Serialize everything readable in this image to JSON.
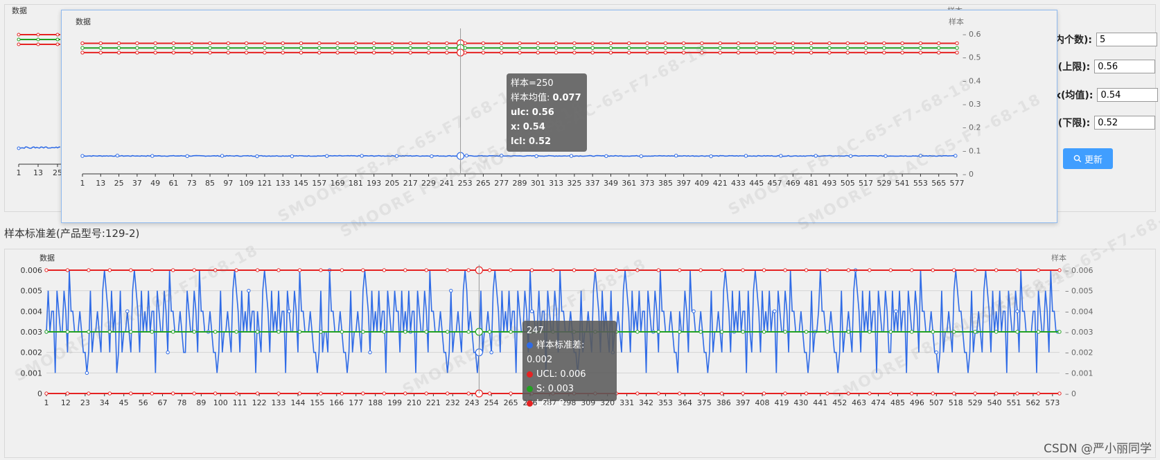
{
  "watermark": "SMOORE F8-AC-65-F7-68-18",
  "params": {
    "group_size_label": "内个数):",
    "group_size_value": "5",
    "ucl_label": "l(上限):",
    "ucl_value": "0.56",
    "mean_label": "x(均值):",
    "mean_value": "0.54",
    "lcl_label": "l(下限):",
    "lcl_value": "0.52",
    "update_label": "更新"
  },
  "s_chart_title": "样本标准差(产品型号:129-2)",
  "xbar_tooltip": {
    "sample": "样本=250",
    "mean_label": "样本均值:",
    "mean_value": "0.077",
    "ucl_label": "ulc:",
    "ucl_value": "0.56",
    "x_label": "x:",
    "x_value": "0.54",
    "lcl_label": "lcl:",
    "lcl_value": "0.52"
  },
  "s_tooltip": {
    "sample": "247",
    "series_s": "样本标准差: 0.002",
    "series_ucl": "UCL: 0.006",
    "series_mean": "S: 0.003",
    "series_lcl": "LCL: 0"
  },
  "csdn_credit": "CSDN @严小丽同学",
  "chart_data": [
    {
      "id": "xbar-background",
      "type": "line",
      "xlabel": "",
      "ylabel": "数据",
      "ylabel_right": "样本",
      "x_ticks_visible": [
        "1",
        "13",
        "25"
      ],
      "series_colors": {
        "value": "#2f6be6",
        "ucl": "#e52222",
        "mean": "#21a121",
        "lcl": "#e52222"
      }
    },
    {
      "id": "xbar-popup",
      "type": "line",
      "ylabel": "数据",
      "ylabel_right": "样本",
      "n_points": 577,
      "x_tick_step": 12,
      "ylim": [
        0,
        0.6
      ],
      "y_ticks": [
        0,
        0.1,
        0.2,
        0.3,
        0.4,
        0.5,
        0.6
      ],
      "series": [
        {
          "name": "样本均值",
          "color": "#2f6be6",
          "base": 0.077,
          "noise": 0.003
        },
        {
          "name": "ulc",
          "color": "#e52222",
          "constant": 0.56
        },
        {
          "name": "x",
          "color": "#21a121",
          "constant": 0.54
        },
        {
          "name": "lcl",
          "color": "#e52222",
          "constant": 0.52
        }
      ],
      "highlight_index": 250
    },
    {
      "id": "s-chart",
      "type": "line",
      "ylabel": "数据",
      "ylabel_right": "样本",
      "n_points": 577,
      "x_tick_step": 11,
      "ylim": [
        0,
        0.006
      ],
      "y_ticks": [
        0,
        0.001,
        0.002,
        0.003,
        0.004,
        0.005,
        0.006
      ],
      "series": [
        {
          "name": "样本标准差",
          "color": "#2f6be6",
          "values_pattern": [
            0.003,
            0.001,
            0.005,
            0.004,
            0.002,
            0.004,
            0.003,
            0.005,
            0.002,
            0.004,
            0.003,
            0.006,
            0.002,
            0.004,
            0.003,
            0.005,
            0.003,
            0.002,
            0.004,
            0.005,
            0.003,
            0.004,
            0.002,
            0.003,
            0.005,
            0.004,
            0.003,
            0.002,
            0.004,
            0.003,
            0.005,
            0.006,
            0.003,
            0.004,
            0.002,
            0.001,
            0.003,
            0.004,
            0.005,
            0.003
          ]
        },
        {
          "name": "UCL",
          "color": "#e52222",
          "constant": 0.006
        },
        {
          "name": "S",
          "color": "#21a121",
          "constant": 0.003
        },
        {
          "name": "LCL",
          "color": "#e52222",
          "constant": 0
        }
      ],
      "highlight_index": 247
    }
  ]
}
